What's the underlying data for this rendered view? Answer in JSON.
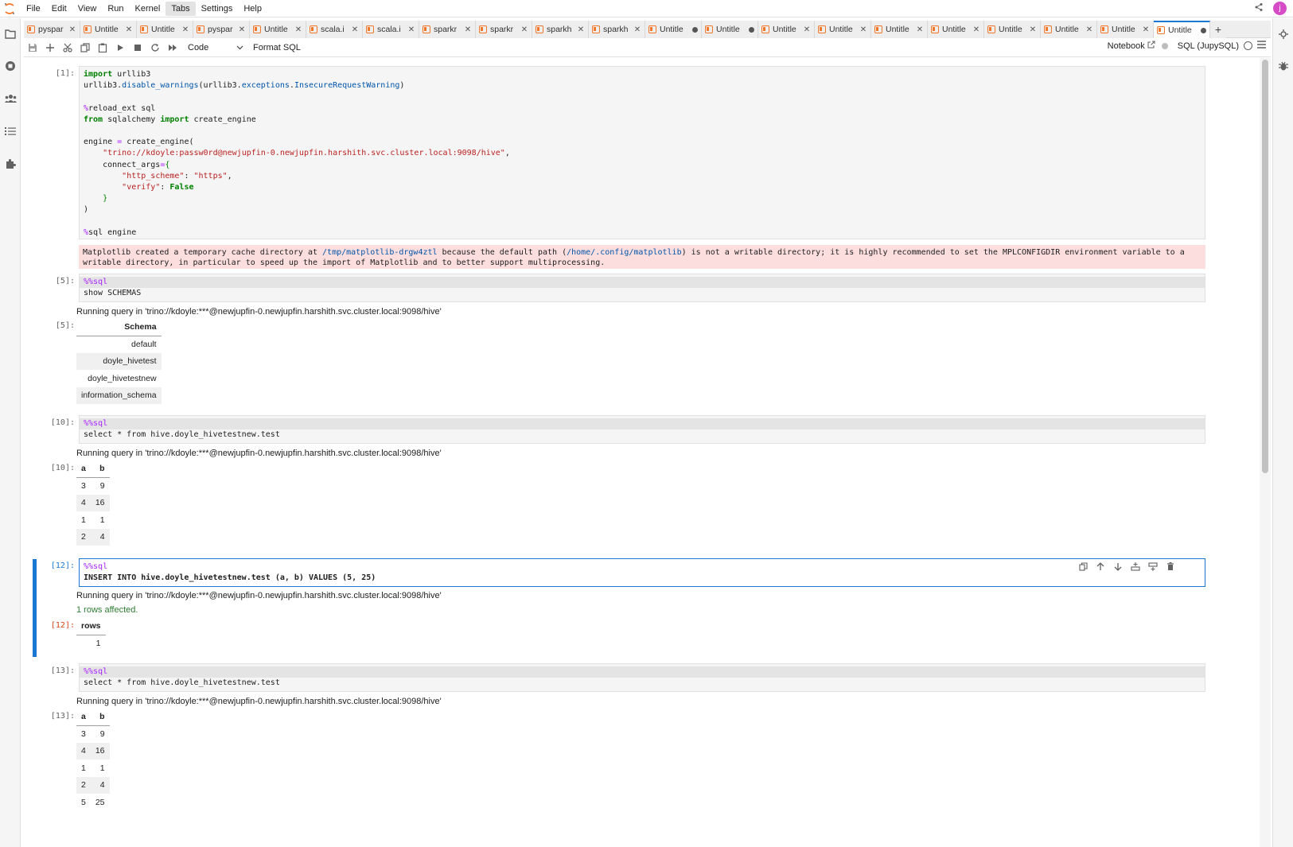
{
  "menubar": {
    "items": [
      "File",
      "Edit",
      "View",
      "Run",
      "Kernel",
      "Tabs",
      "Settings",
      "Help"
    ],
    "active_index": 5,
    "user_initial": "j"
  },
  "tabs": [
    {
      "label": "pyspar",
      "state": "close"
    },
    {
      "label": "Untitle",
      "state": "close"
    },
    {
      "label": "Untitle",
      "state": "close"
    },
    {
      "label": "pyspar",
      "state": "close"
    },
    {
      "label": "Untitle",
      "state": "close"
    },
    {
      "label": "scala.i",
      "state": "close"
    },
    {
      "label": "scala.i",
      "state": "close"
    },
    {
      "label": "sparkr",
      "state": "close"
    },
    {
      "label": "sparkr",
      "state": "close"
    },
    {
      "label": "sparkh",
      "state": "close"
    },
    {
      "label": "sparkh",
      "state": "close"
    },
    {
      "label": "Untitle",
      "state": "dot"
    },
    {
      "label": "Untitle",
      "state": "dot"
    },
    {
      "label": "Untitle",
      "state": "close"
    },
    {
      "label": "Untitle",
      "state": "close"
    },
    {
      "label": "Untitle",
      "state": "close"
    },
    {
      "label": "Untitle",
      "state": "close"
    },
    {
      "label": "Untitle",
      "state": "close"
    },
    {
      "label": "Untitle",
      "state": "close"
    },
    {
      "label": "Untitle",
      "state": "close"
    },
    {
      "label": "Untitle",
      "state": "dot",
      "active": true
    }
  ],
  "toolbar": {
    "cell_type": "Code",
    "format_label": "Format SQL",
    "notebook_label": "Notebook",
    "kernel_label": "SQL (JupySQL)"
  },
  "cells": {
    "c1": {
      "prompt": "[1]:",
      "stderr": {
        "pre": "Matplotlib created a temporary cache directory at ",
        "path1": "/tmp/matplotlib-drgw4ztl",
        "mid": " because the default path (",
        "path2": "/home/.config/matplotlib",
        "post": ") is not a writable directory; it is highly recommended to set the MPLCONFIGDIR environment variable to a writable directory, in particular to speed up the import of Matplotlib and to better support multiprocessing."
      }
    },
    "c5": {
      "prompt": "[5]:",
      "line1": "%%sql",
      "line2": "show SCHEMAS",
      "running": "Running query in 'trino://kdoyle:***@newjupfin-0.newjupfin.harshith.svc.cluster.local:9098/hive'",
      "out_prompt": "[5]:",
      "header": "Schema",
      "rows": [
        "default",
        "doyle_hivetest",
        "doyle_hivetestnew",
        "information_schema"
      ]
    },
    "c10": {
      "prompt": "[10]:",
      "line1": "%%sql",
      "line2": "select * from hive.doyle_hivetestnew.test",
      "running": "Running query in 'trino://kdoyle:***@newjupfin-0.newjupfin.harshith.svc.cluster.local:9098/hive'",
      "out_prompt": "[10]:",
      "headers": [
        "a",
        "b"
      ],
      "rows": [
        [
          "3",
          "9"
        ],
        [
          "4",
          "16"
        ],
        [
          "1",
          "1"
        ],
        [
          "2",
          "4"
        ]
      ]
    },
    "c12": {
      "prompt": "[12]:",
      "line1": "%%sql",
      "line2": "INSERT INTO hive.doyle_hivetestnew.test (a, b) VALUES (5, 25)",
      "running": "Running query in 'trino://kdoyle:***@newjupfin-0.newjupfin.harshith.svc.cluster.local:9098/hive'",
      "affected": "1 rows affected.",
      "out_prompt": "[12]:",
      "header": "rows",
      "value": "1"
    },
    "c13": {
      "prompt": "[13]:",
      "line1": "%%sql",
      "line2": "select * from hive.doyle_hivetestnew.test",
      "running": "Running query in 'trino://kdoyle:***@newjupfin-0.newjupfin.harshith.svc.cluster.local:9098/hive'",
      "out_prompt": "[13]:",
      "headers": [
        "a",
        "b"
      ],
      "rows": [
        [
          "3",
          "9"
        ],
        [
          "4",
          "16"
        ],
        [
          "1",
          "1"
        ],
        [
          "2",
          "4"
        ],
        [
          "5",
          "25"
        ]
      ]
    }
  },
  "colors": {
    "accent": "#1976d2",
    "stderr_bg": "#fddede",
    "notebook_icon": "#f37726"
  }
}
